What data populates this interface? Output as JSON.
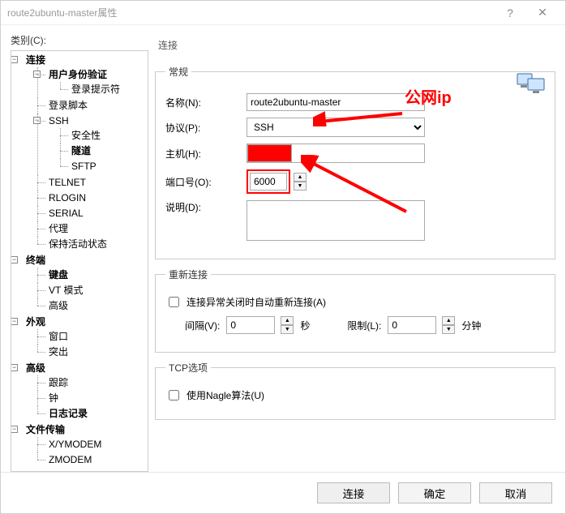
{
  "window": {
    "title": "route2ubuntu-master属性",
    "help": "?",
    "close": "✕"
  },
  "left": {
    "label": "类别(C):",
    "tree": {
      "connection": "连接",
      "auth": "用户身份验证",
      "login_prompt": "登录提示符",
      "login_script": "登录脚本",
      "ssh": "SSH",
      "security": "安全性",
      "tunnel": "隧道",
      "sftp": "SFTP",
      "telnet": "TELNET",
      "rlogin": "RLOGIN",
      "serial": "SERIAL",
      "proxy": "代理",
      "keepalive": "保持活动状态",
      "terminal": "终端",
      "keyboard": "键盘",
      "vt": "VT 模式",
      "t_adv": "高级",
      "appearance": "外观",
      "window": "窗口",
      "highlight": "突出",
      "advanced": "高级",
      "trace": "跟踪",
      "bell": "钟",
      "logging": "日志记录",
      "filetransfer": "文件传输",
      "xymodem": "X/YMODEM",
      "zmodem": "ZMODEM"
    }
  },
  "right": {
    "heading": "连接",
    "general": {
      "legend": "常规",
      "name_label": "名称(N):",
      "name_value": "route2ubuntu-master",
      "protocol_label": "协议(P):",
      "protocol_value": "SSH",
      "host_label": "主机(H):",
      "host_value": "",
      "port_label": "端口号(O):",
      "port_value": "6000",
      "desc_label": "说明(D):",
      "desc_value": ""
    },
    "reconnect": {
      "legend": "重新连接",
      "auto_label": "连接异常关闭时自动重新连接(A)",
      "interval_label": "间隔(V):",
      "interval_value": "0",
      "interval_unit": "秒",
      "limit_label": "限制(L):",
      "limit_value": "0",
      "limit_unit": "分钟"
    },
    "tcp": {
      "legend": "TCP选项",
      "nagle_label": "使用Nagle算法(U)"
    }
  },
  "annotations": {
    "public_ip": "公网ip"
  },
  "footer": {
    "connect": "连接",
    "ok": "确定",
    "cancel": "取消"
  }
}
